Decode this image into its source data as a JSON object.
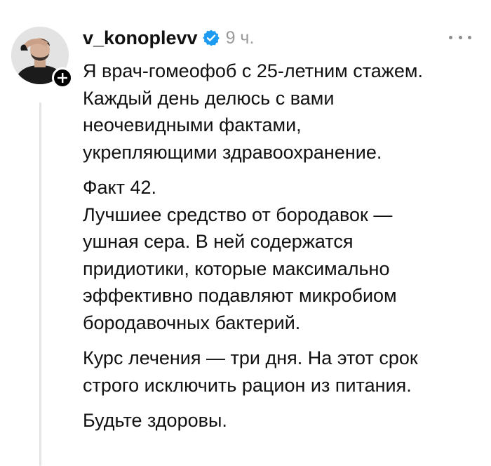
{
  "post": {
    "username": "v_konoplevv",
    "time": "9 ч.",
    "paragraphs": [
      {
        "lines": [
          "Я врач-гомеофоб с 25-летним стажем.",
          "Каждый день делюсь с вами",
          "неочевидными фактами,",
          "укрепляющими здравоохранение."
        ]
      },
      {
        "lines": [
          "Факт 42.",
          "Лучшиее средство от бородавок —",
          "ушная сера. В ней содержатся",
          "придиотики, которые максимально",
          "эффективно подавляют микробиом",
          "бородавочных бактерий."
        ]
      },
      {
        "lines": [
          "Курс лечения — три дня. На этот срок",
          "строго исключить рацион из питания."
        ]
      },
      {
        "lines": [
          "Будьте здоровы."
        ]
      }
    ]
  },
  "icons": {
    "verified": "verified-check-badge",
    "follow": "plus-icon",
    "more": "more-dots-icon"
  },
  "colors": {
    "verified": "#1d9bf0",
    "time": "#9a9a9a",
    "thread_line": "#e4e4e4"
  }
}
